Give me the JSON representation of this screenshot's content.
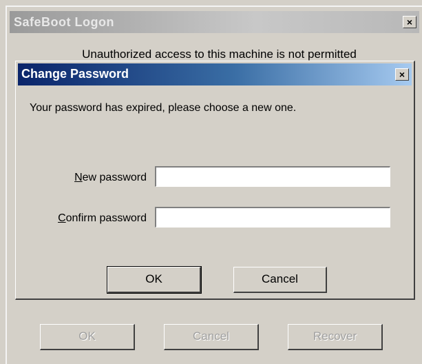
{
  "outer_window": {
    "title": "SafeBoot Logon",
    "warning": "Unauthorized access to this machine is not permitted",
    "buttons": {
      "ok": "OK",
      "cancel": "Cancel",
      "recover": "Recover"
    }
  },
  "dialog": {
    "title": "Change Password",
    "message": "Your password has expired, please choose a new one.",
    "new_password": {
      "label_mnemonic": "N",
      "label_rest": "ew password",
      "value": ""
    },
    "confirm_password": {
      "label_mnemonic": "C",
      "label_rest": "onfirm password",
      "value": ""
    },
    "ok_label": "OK",
    "cancel_label": "Cancel"
  },
  "close_glyph": "×"
}
